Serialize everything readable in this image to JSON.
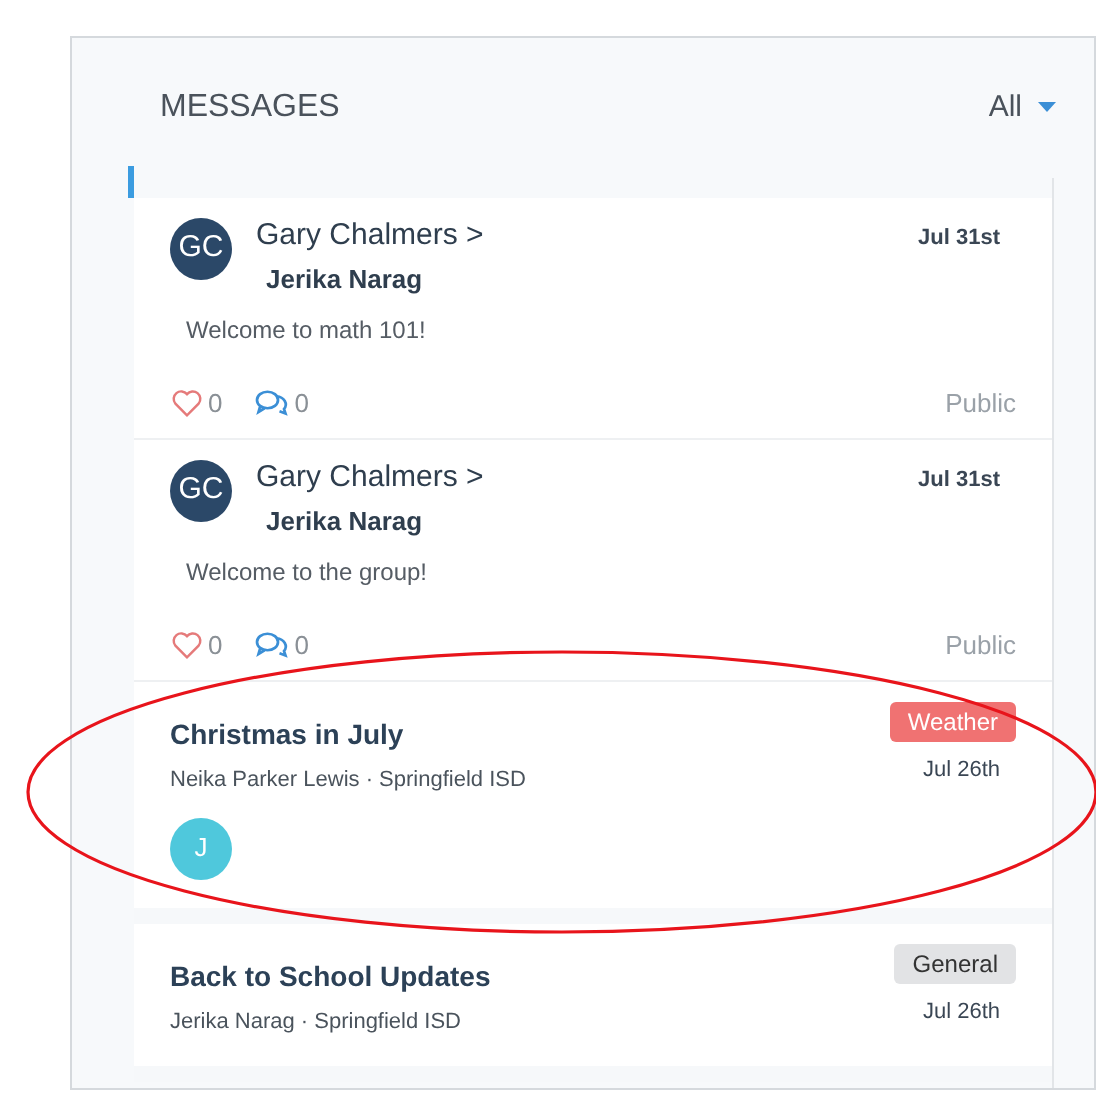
{
  "header": {
    "title": "MESSAGES",
    "filter": "All"
  },
  "posts": [
    {
      "kind": "message",
      "initials": "GC",
      "sender": "Gary Chalmers >",
      "recipient": "Jerika Narag",
      "date": "Jul 31st",
      "text": "Welcome to math 101!",
      "likes": "0",
      "comments": "0",
      "visibility": "Public"
    },
    {
      "kind": "message",
      "initials": "GC",
      "sender": "Gary Chalmers >",
      "recipient": "Jerika Narag",
      "date": "Jul 31st",
      "text": "Welcome to the group!",
      "likes": "0",
      "comments": "0",
      "visibility": "Public"
    },
    {
      "kind": "announcement",
      "title": "Christmas in July",
      "meta": "Neika Parker Lewis · Springfield ISD",
      "tag": {
        "label": "Weather",
        "color": "#f07272"
      },
      "date": "Jul 26th",
      "participants": [
        {
          "initial": "J",
          "color": "#4fc8dc"
        }
      ]
    },
    {
      "kind": "announcement",
      "title": "Back to School Updates",
      "meta": "Jerika Narag · Springfield ISD",
      "tag": {
        "label": "General",
        "color": "#e2e3e5"
      },
      "date": "Jul 26th"
    }
  ],
  "highlight": {
    "kind": "ellipse"
  }
}
